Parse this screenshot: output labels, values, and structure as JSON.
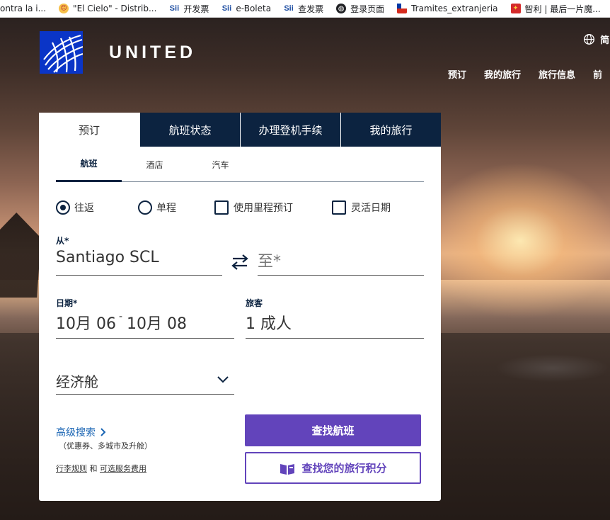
{
  "bookmarks": [
    {
      "label": "ontra la i...",
      "icon": "none"
    },
    {
      "label": "\"El Cielo\" - Distrib...",
      "icon": "cielo-icon"
    },
    {
      "label": "开发票",
      "icon": "sii-icon"
    },
    {
      "label": "e-Boleta",
      "icon": "sii-icon"
    },
    {
      "label": "查发票",
      "icon": "sii-icon"
    },
    {
      "label": "登录页面",
      "icon": "globe-icon"
    },
    {
      "label": "Tramites_extranjeria",
      "icon": "chile-flag-icon"
    },
    {
      "label": "智利 | 最后一片魔...",
      "icon": "game-icon"
    }
  ],
  "header": {
    "brand": "UNITED",
    "lang": "简",
    "nav": [
      "预订",
      "我的旅行",
      "旅行信息",
      "前"
    ]
  },
  "tabs": [
    "预订",
    "航班状态",
    "办理登机手续",
    "我的旅行"
  ],
  "subtabs": [
    "航班",
    "酒店",
    "汽车"
  ],
  "options": {
    "roundtrip": "往返",
    "oneway": "单程",
    "miles": "使用里程预订",
    "flexible": "灵活日期"
  },
  "from": {
    "label": "从*",
    "value": "Santiago SCL"
  },
  "to": {
    "placeholder": "至*"
  },
  "dates": {
    "label": "日期*",
    "depart": "10月 06",
    "separator": "-",
    "return": "10月 08"
  },
  "travelers": {
    "label": "旅客",
    "value": "1 成人"
  },
  "cabin": {
    "value": "经济舱"
  },
  "advanced": {
    "label": "高级搜索",
    "note": "（优惠券、多城市及升舱）"
  },
  "links": {
    "baggage": "行李规则",
    "and": " 和 ",
    "fees": "可选服务费用"
  },
  "buttons": {
    "search": "查找航班",
    "award": "查找您的旅行积分"
  },
  "colors": {
    "navy": "#0c2340",
    "purple": "#6244bb",
    "logo_blue": "#0a35c7"
  }
}
